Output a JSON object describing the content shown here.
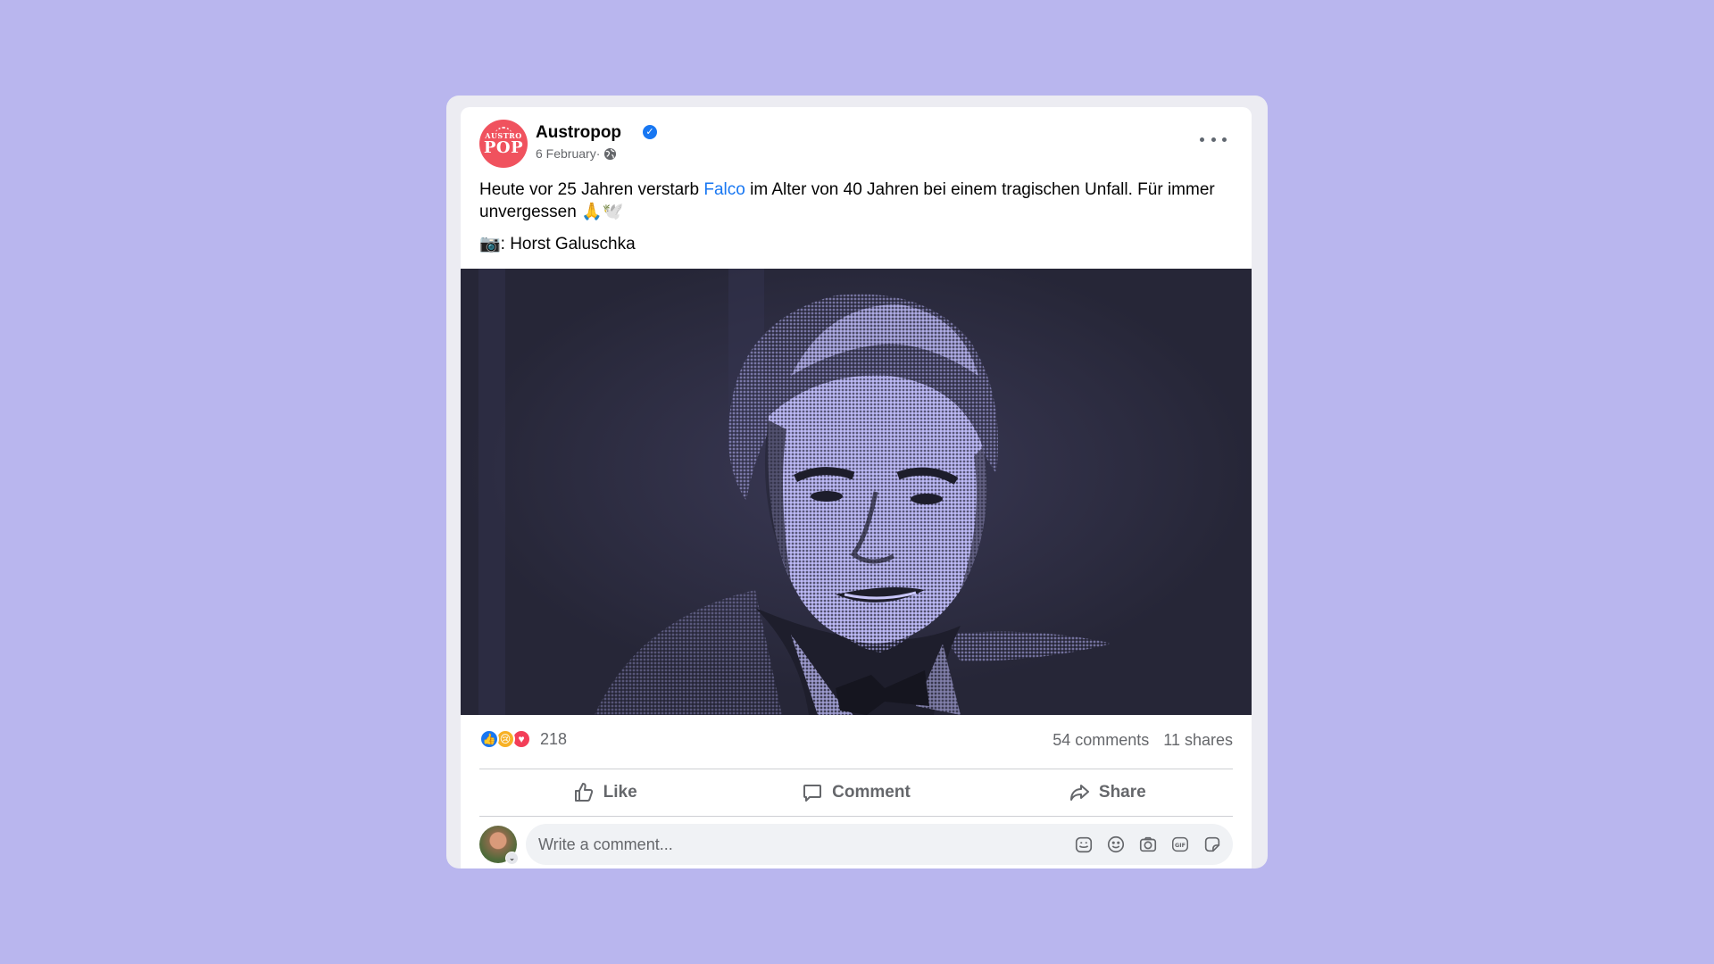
{
  "post": {
    "page_name": "Austropop",
    "avatar_top": "AUSTRO",
    "avatar_bottom": "POP",
    "date": "6 February",
    "separator": " · ",
    "text_before": "Heute vor 25 Jahren verstarb ",
    "text_link": "Falco",
    "text_after": " im Alter von 40 Jahren bei einem tragischen Unfall. Für immer unvergessen 🙏🕊️",
    "credit": "📷: Horst Galuschka"
  },
  "stats": {
    "reaction_count": "218",
    "comments": "54 comments",
    "shares": "11 shares"
  },
  "actions": {
    "like": "Like",
    "comment": "Comment",
    "share": "Share"
  },
  "composer": {
    "placeholder": "Write a comment..."
  },
  "colors": {
    "background": "#b9b6ee",
    "link": "#1877f2",
    "photo_tint": "#aaa8ee"
  },
  "icons": [
    "verified-icon",
    "globe-icon",
    "more-icon",
    "like-icon",
    "comment-icon",
    "share-icon",
    "avatar-sticker-icon",
    "emoji-icon",
    "camera-icon",
    "gif-icon",
    "sticker-icon"
  ]
}
